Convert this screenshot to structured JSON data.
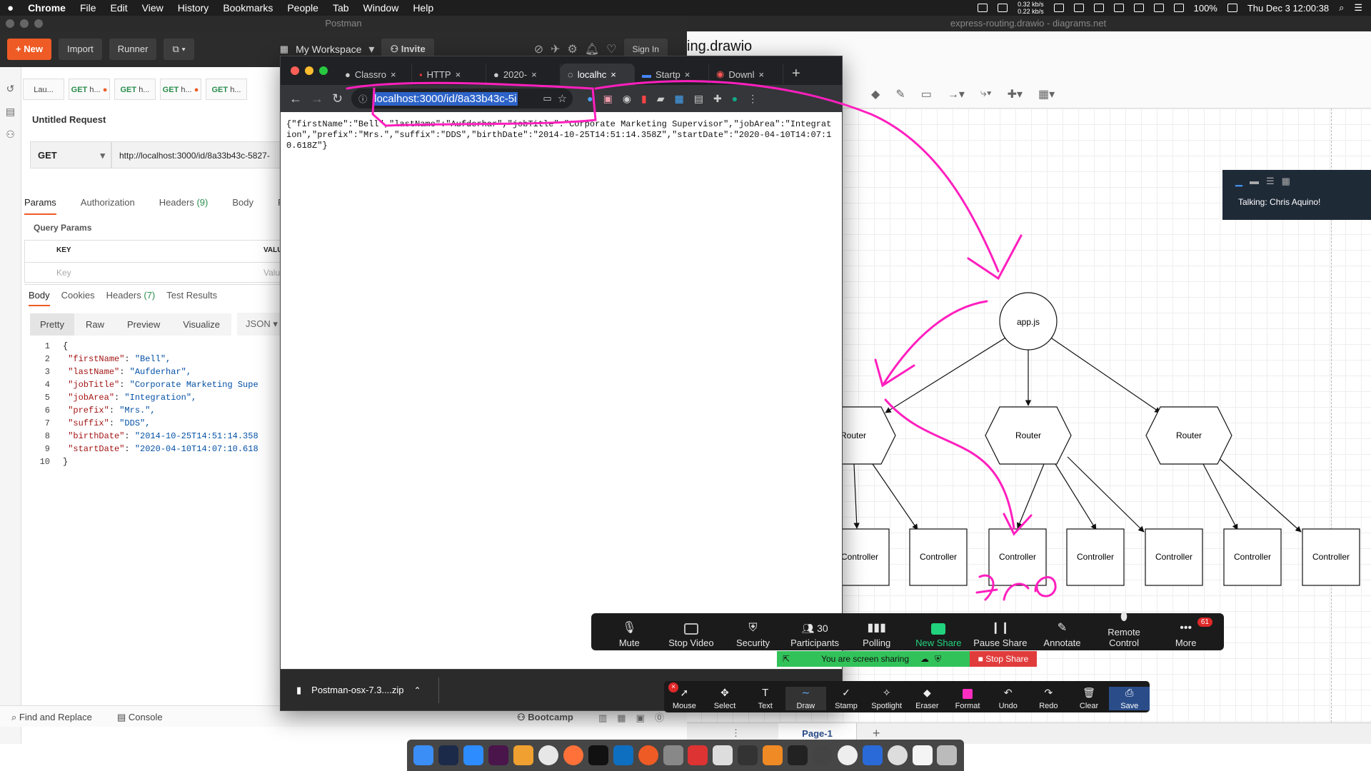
{
  "menubar": {
    "app": "Chrome",
    "items": [
      "File",
      "Edit",
      "View",
      "History",
      "Bookmarks",
      "People",
      "Tab",
      "Window",
      "Help"
    ],
    "net_up": "0.32 kb/s",
    "net_down": "0.22 kb/s",
    "battery": "100%",
    "datetime": "Thu Dec 3  12:00:38"
  },
  "drawio": {
    "window_title": "express-routing.drawio - diagrams.net",
    "doc_name": "ing.drawio",
    "page_tab": "Page-1",
    "nodes": {
      "root": "app.js",
      "routers": [
        "Router",
        "Router",
        "Router"
      ],
      "controllers": [
        "Controller",
        "Controller",
        "Controller",
        "Controller",
        "Controller",
        "Controller",
        "Controller"
      ]
    }
  },
  "postman": {
    "window_title": "Postman",
    "new_label": "New",
    "import_label": "Import",
    "runner_label": "Runner",
    "workspace": "My Workspace",
    "invite": "Invite",
    "sign_in": "Sign In",
    "tabs": [
      {
        "method": "",
        "label": "Lau..."
      },
      {
        "method": "GET",
        "label": "h..."
      },
      {
        "method": "GET",
        "label": "h..."
      },
      {
        "method": "GET",
        "label": "h..."
      },
      {
        "method": "GET",
        "label": "h..."
      }
    ],
    "request_title": "Untitled Request",
    "method": "GET",
    "url": "http://localhost:3000/id/8a33b43c-5827-",
    "req_tabs": [
      "Params",
      "Authorization",
      "Headers",
      "Body",
      "P"
    ],
    "headers_count": "(9)",
    "query_params": "Query Params",
    "col_key": "KEY",
    "col_value": "VALU",
    "key_placeholder": "Key",
    "value_placeholder": "Valu",
    "resp_tabs": [
      "Body",
      "Cookies",
      "Headers",
      "Test Results"
    ],
    "resp_headers_count": "(7)",
    "view_tabs": [
      "Pretty",
      "Raw",
      "Preview",
      "Visualize"
    ],
    "format": "JSON",
    "lines": [
      {
        "n": "1",
        "t": "{"
      },
      {
        "n": "2",
        "k": "\"firstName\"",
        "v": "\"Bell\","
      },
      {
        "n": "3",
        "k": "\"lastName\"",
        "v": "\"Aufderhar\","
      },
      {
        "n": "4",
        "k": "\"jobTitle\"",
        "v": "\"Corporate Marketing Supe"
      },
      {
        "n": "5",
        "k": "\"jobArea\"",
        "v": "\"Integration\","
      },
      {
        "n": "6",
        "k": "\"prefix\"",
        "v": "\"Mrs.\","
      },
      {
        "n": "7",
        "k": "\"suffix\"",
        "v": "\"DDS\","
      },
      {
        "n": "8",
        "k": "\"birthDate\"",
        "v": "\"2014-10-25T14:51:14.358"
      },
      {
        "n": "9",
        "k": "\"startDate\"",
        "v": "\"2020-04-10T14:07:10.618"
      },
      {
        "n": "10",
        "t": "}"
      }
    ],
    "find_replace": "Find and Replace",
    "console": "Console",
    "bootcamp": "Bootcamp"
  },
  "chrome": {
    "tabs": [
      "Classro",
      "HTTP",
      "2020-",
      "localhc",
      "Startp",
      "Downl"
    ],
    "address": "localhost:3000/id/8a33b43c-5i",
    "body_text": "{\"firstName\":\"Bell\",\"lastName\":\"Aufderhar\",\"jobTitle\":\"Corporate Marketing Supervisor\",\"jobArea\":\"Integration\",\"prefix\":\"Mrs.\",\"suffix\":\"DDS\",\"birthDate\":\"2014-10-25T14:51:14.358Z\",\"startDate\":\"2020-04-10T14:07:10.618Z\"}",
    "download": "Postman-osx-7.3....zip"
  },
  "zoom": {
    "buttons": [
      "Mute",
      "Stop Video",
      "Security",
      "Participants",
      "Polling",
      "New Share",
      "Pause Share",
      "Annotate",
      "Remote Control",
      "More"
    ],
    "participants_count": "30",
    "more_badge": "61",
    "sharing_text": "You are screen sharing",
    "stop_share": "Stop Share",
    "annotate_tools": [
      "Mouse",
      "Select",
      "Text",
      "Draw",
      "Stamp",
      "Spotlight",
      "Eraser",
      "Format",
      "Undo",
      "Redo",
      "Clear",
      "Save"
    ],
    "talking": "Talking: Chris Aquino!"
  }
}
